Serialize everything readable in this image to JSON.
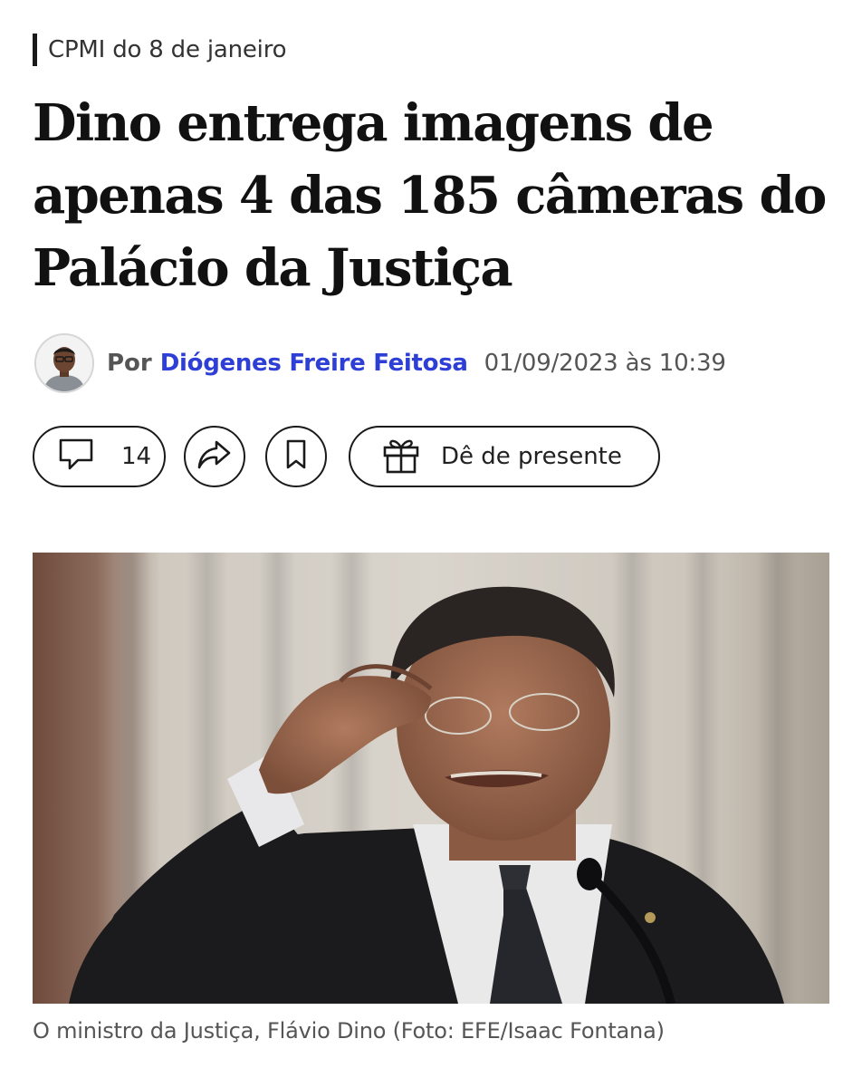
{
  "section": {
    "label": "CPMI do 8 de janeiro"
  },
  "article": {
    "headline": "Dino entrega imagens de apenas 4 das 185 câmeras do Palácio da Justiça",
    "byline": {
      "prefix": "Por",
      "author": "Diógenes Freire Feitosa",
      "timestamp": "01/09/2023 às 10:39"
    },
    "photo_caption": "O ministro da Justiça, Flávio Dino (Foto: EFE/Isaac Fontana)"
  },
  "actions": {
    "comments_icon": "comment-icon",
    "comments_count": "14",
    "share_icon": "share-icon",
    "save_icon": "bookmark-icon",
    "gift_icon": "gift-icon",
    "gift_label": "Dê de presente"
  },
  "colors": {
    "author_link": "#2e3fd6",
    "text_primary": "#111111",
    "text_secondary": "#555555",
    "button_border": "#1a1a1a"
  }
}
